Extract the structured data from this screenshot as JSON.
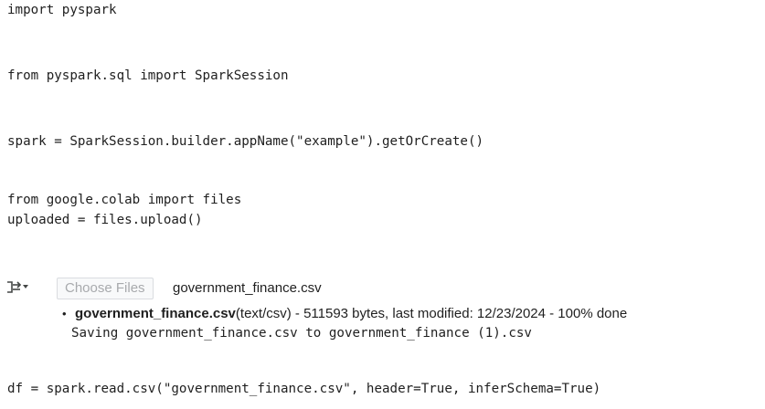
{
  "code": {
    "line1": "import pyspark",
    "line2": "from pyspark.sql import SparkSession",
    "line3": "spark = SparkSession.builder.appName(\"example\").getOrCreate()",
    "line4": "from google.colab import files",
    "line5": "uploaded = files.upload()",
    "line6": "df = spark.read.csv(\"government_finance.csv\", header=True, inferSchema=True)"
  },
  "output": {
    "icon": "output-toggle-icon",
    "choose_files_label": "Choose Files",
    "chosen_file": "government_finance.csv",
    "file_name": "government_finance.csv",
    "file_details": "(text/csv) - 511593 bytes, last modified: 12/23/2024 - 100% done",
    "saving_message": "Saving government_finance.csv to government_finance (1).csv"
  }
}
